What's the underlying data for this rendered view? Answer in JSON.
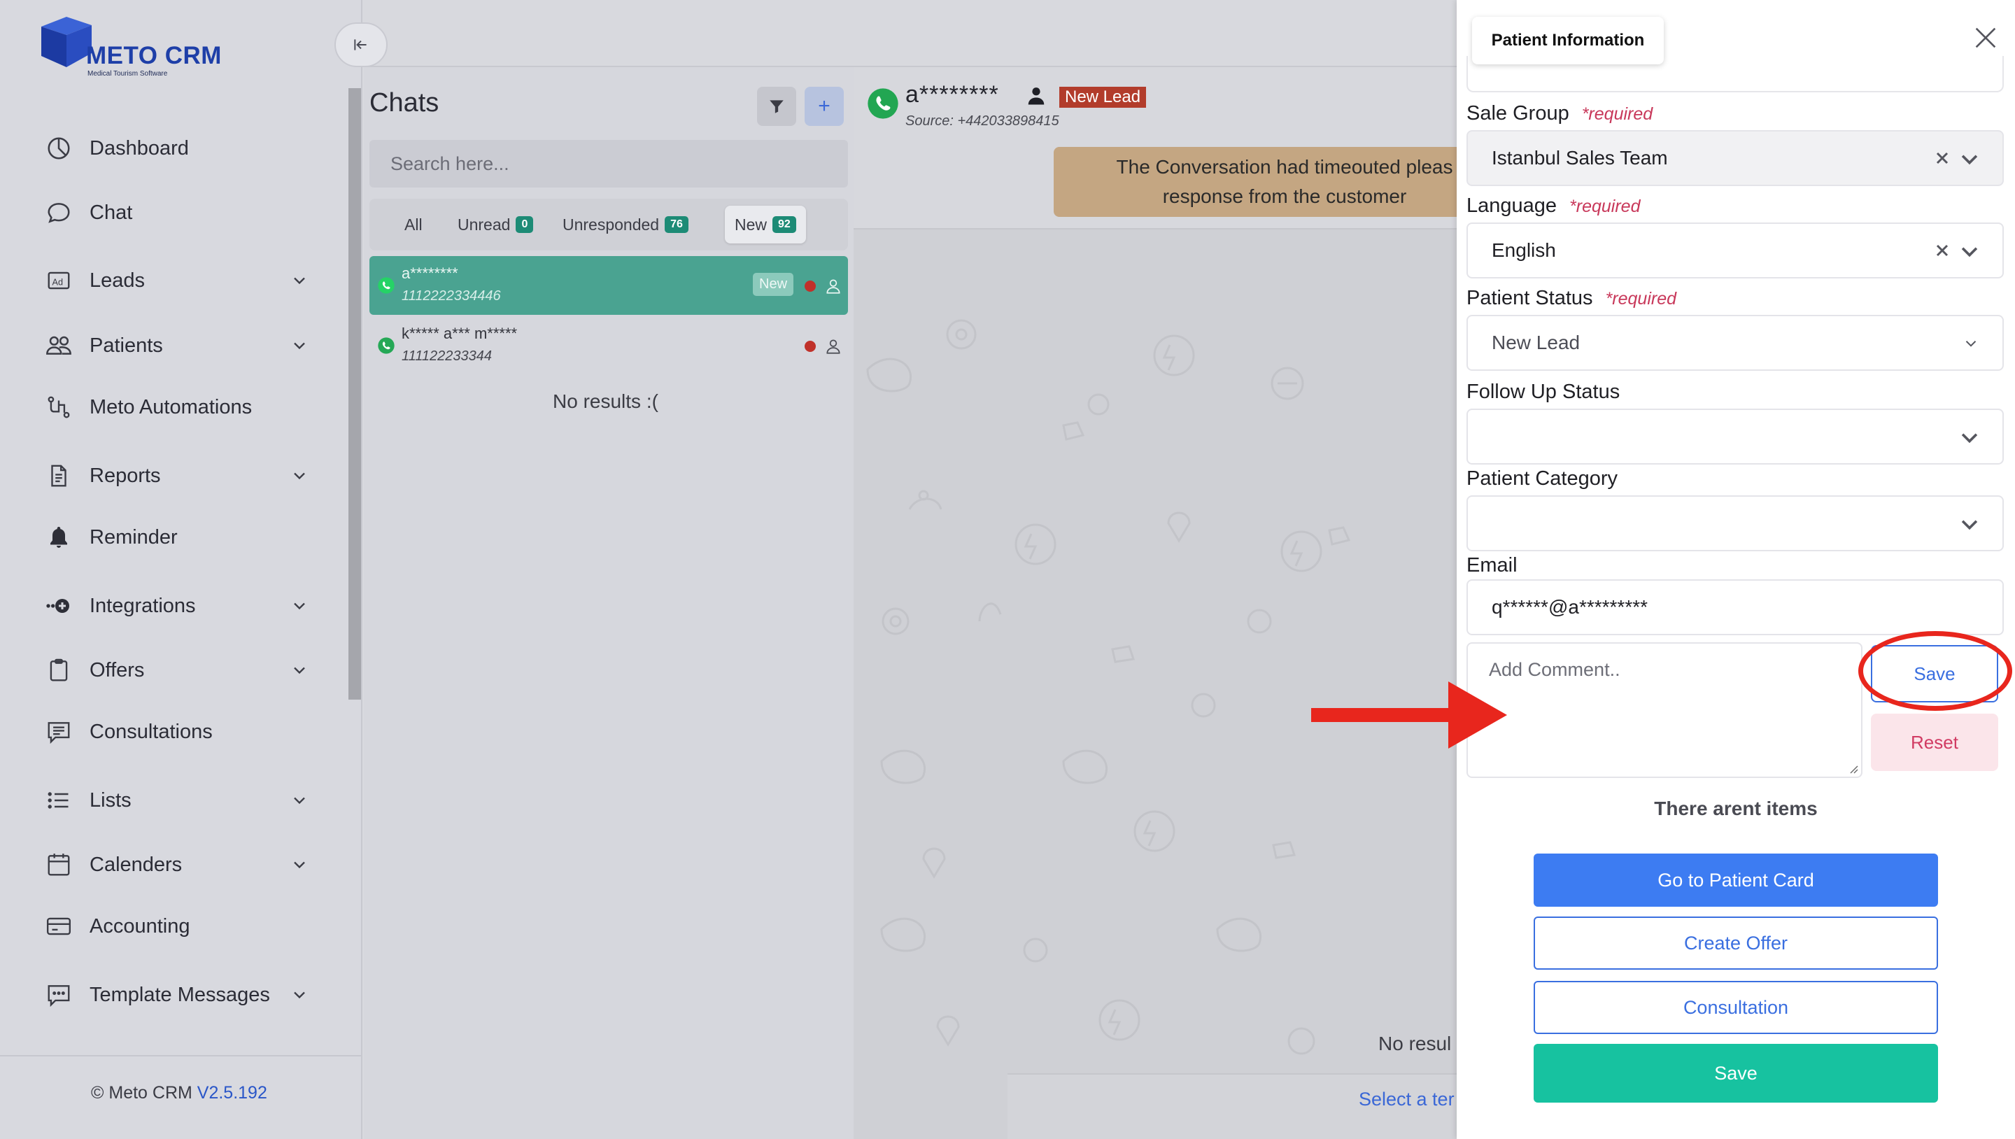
{
  "logo": {
    "name": "METO CRM",
    "tagline": "Medical Tourism Software"
  },
  "sidebar": {
    "items": [
      {
        "label": "Dashboard",
        "icon": "dashboard-icon",
        "has_chevron": false
      },
      {
        "label": "Chat",
        "icon": "chat-icon",
        "has_chevron": false
      },
      {
        "label": "Leads",
        "icon": "ad-icon",
        "has_chevron": true
      },
      {
        "label": "Patients",
        "icon": "users-icon",
        "has_chevron": true
      },
      {
        "label": "Meto Automations",
        "icon": "automation-icon",
        "has_chevron": false
      },
      {
        "label": "Reports",
        "icon": "document-icon",
        "has_chevron": true
      },
      {
        "label": "Reminder",
        "icon": "bell-icon",
        "has_chevron": false
      },
      {
        "label": "Integrations",
        "icon": "integrations-icon",
        "has_chevron": true
      },
      {
        "label": "Offers",
        "icon": "clipboard-icon",
        "has_chevron": true
      },
      {
        "label": "Consultations",
        "icon": "message-list-icon",
        "has_chevron": false
      },
      {
        "label": "Lists",
        "icon": "list-icon",
        "has_chevron": true
      },
      {
        "label": "Calenders",
        "icon": "calendar-icon",
        "has_chevron": true
      },
      {
        "label": "Accounting",
        "icon": "credit-card-icon",
        "has_chevron": false
      },
      {
        "label": "Template Messages",
        "icon": "template-message-icon",
        "has_chevron": true
      }
    ],
    "footer": {
      "copyright": "© Meto CRM",
      "version": "V2.5.192"
    }
  },
  "chats": {
    "title": "Chats",
    "search_placeholder": "Search here...",
    "tabs": [
      {
        "label": "All",
        "count": null
      },
      {
        "label": "Unread",
        "count": "0"
      },
      {
        "label": "Unresponded",
        "count": "76"
      },
      {
        "label": "New",
        "count": "92"
      }
    ],
    "active_tab": "New",
    "items": [
      {
        "name": "a********",
        "phone": "1112222334446",
        "badge": "New",
        "selected": true
      },
      {
        "name": "k***** a*** m*****",
        "phone": "111122233344",
        "badge": "",
        "selected": false
      }
    ],
    "no_results": "No results :("
  },
  "conversation": {
    "contact_name": "a********",
    "status_badge": "New Lead",
    "source": "Source: +442033898415",
    "timeout_line1": "The Conversation had timeouted pleas",
    "timeout_line2": "response from the customer",
    "no_results": "No resul",
    "select_template": "Select a ter"
  },
  "panel": {
    "tab_title": "Patient Information",
    "required_label": "*required",
    "fields": {
      "sale_group": {
        "label": "Sale Group",
        "value": "Istanbul Sales Team"
      },
      "language": {
        "label": "Language",
        "value": "English"
      },
      "patient_status": {
        "label": "Patient Status",
        "value": "New Lead"
      },
      "follow_up_status": {
        "label": "Follow Up Status",
        "value": ""
      },
      "patient_category": {
        "label": "Patient Category",
        "value": ""
      },
      "email": {
        "label": "Email",
        "value": "q******@a*********"
      }
    },
    "comment_placeholder": "Add Comment..",
    "save_comment": "Save",
    "reset_comment": "Reset",
    "no_items": "There arent items",
    "buttons": {
      "patient_card": "Go to Patient Card",
      "create_offer": "Create Offer",
      "consultation": "Consultation",
      "save": "Save"
    }
  },
  "colors": {
    "brand": "#1e3fa8",
    "whatsapp": "#25d366",
    "selected_chat": "#4aa391",
    "lead_badge": "#b23c2b",
    "primary": "#3d7cf2",
    "success": "#17c2a0",
    "danger": "#c8385a",
    "annotation": "#e8261d"
  }
}
